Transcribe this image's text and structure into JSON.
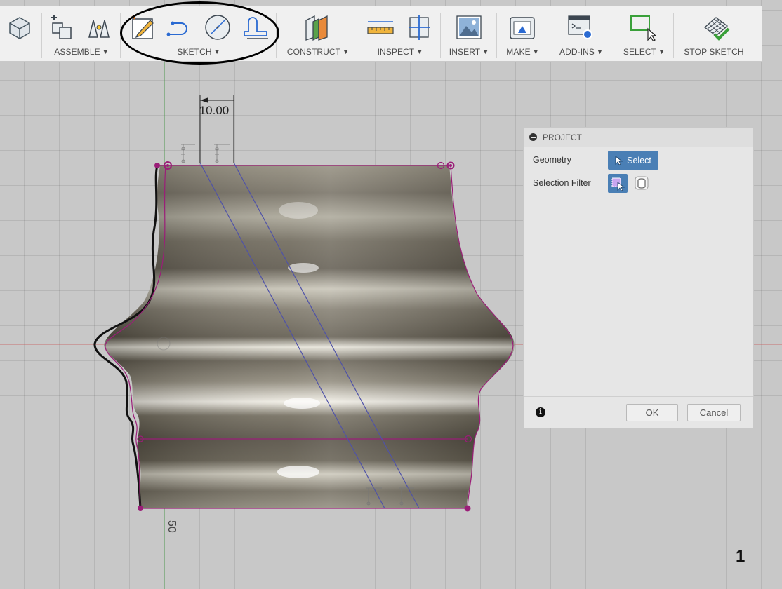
{
  "toolbar": {
    "groups": [
      {
        "label": "ASSEMBLE",
        "icons": [
          "assemble-new-component-icon",
          "joint-icon"
        ]
      },
      {
        "label": "SKETCH",
        "icons": [
          "create-sketch-icon",
          "fillet-curve-icon",
          "circle-icon",
          "offset-icon"
        ]
      },
      {
        "label": "CONSTRUCT",
        "icons": [
          "offset-plane-icon"
        ]
      },
      {
        "label": "INSPECT",
        "icons": [
          "measure-icon",
          "section-analysis-icon"
        ]
      },
      {
        "label": "INSERT",
        "icons": [
          "canvas-image-icon"
        ]
      },
      {
        "label": "MAKE",
        "icons": [
          "3d-print-icon"
        ]
      },
      {
        "label": "ADD-INS",
        "icons": [
          "scripts-addins-icon"
        ]
      },
      {
        "label": "SELECT",
        "icons": [
          "window-select-icon"
        ]
      },
      {
        "label": "STOP SKETCH",
        "icons": [
          "stop-sketch-icon"
        ]
      }
    ],
    "partial_icon": "create-box-icon"
  },
  "canvas": {
    "dimension_top": "10.00",
    "dimension_left": "50",
    "dimension_right": "150"
  },
  "panel": {
    "title": "PROJECT",
    "geometry_label": "Geometry",
    "select_button": "Select",
    "selection_filter_label": "Selection Filter",
    "ok_button": "OK",
    "cancel_button": "Cancel"
  },
  "page_number": "1",
  "colors": {
    "toolbar_bg": "#f0f0f0",
    "canvas_bg": "#c8c8c8",
    "sketch_line": "#9b1e78",
    "construction_line": "#4f52a8",
    "select_button": "#4a7fb5"
  }
}
